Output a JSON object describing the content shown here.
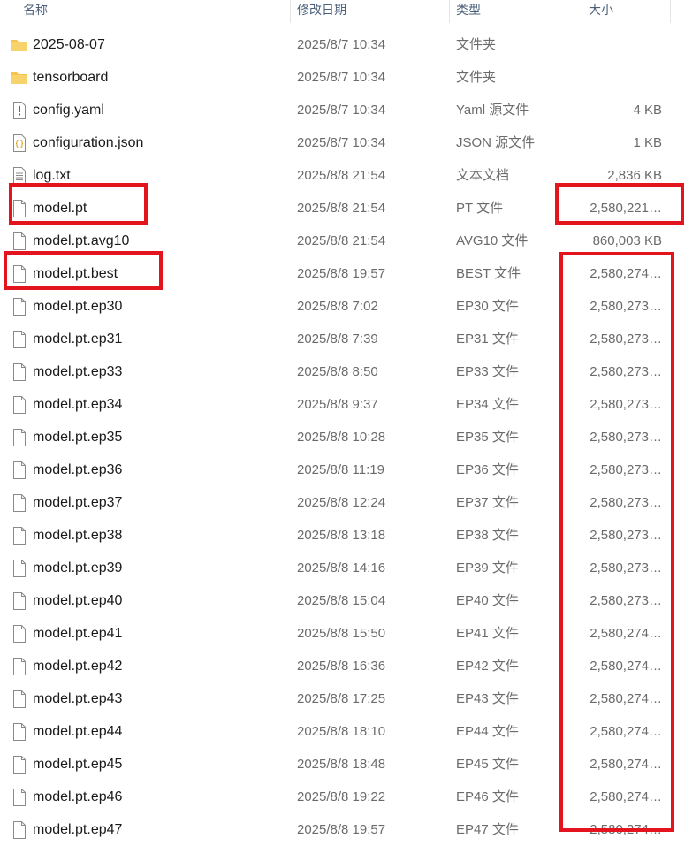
{
  "columns": {
    "name": "名称",
    "modified": "修改日期",
    "type": "类型",
    "size": "大小"
  },
  "files": [
    {
      "name": "2025-08-07",
      "modified": "2025/8/7 10:34",
      "type": "文件夹",
      "size": "",
      "icon": "folder-icon"
    },
    {
      "name": "tensorboard",
      "modified": "2025/8/7 10:34",
      "type": "文件夹",
      "size": "",
      "icon": "folder-icon"
    },
    {
      "name": "config.yaml",
      "modified": "2025/8/7 10:34",
      "type": "Yaml 源文件",
      "size": "4 KB",
      "icon": "yaml-file-icon"
    },
    {
      "name": "configuration.json",
      "modified": "2025/8/7 10:34",
      "type": "JSON 源文件",
      "size": "1 KB",
      "icon": "json-file-icon"
    },
    {
      "name": "log.txt",
      "modified": "2025/8/8 21:54",
      "type": "文本文档",
      "size": "2,836 KB",
      "icon": "text-file-icon"
    },
    {
      "name": "model.pt",
      "modified": "2025/8/8 21:54",
      "type": "PT 文件",
      "size": "2,580,221…",
      "icon": "file-icon"
    },
    {
      "name": "model.pt.avg10",
      "modified": "2025/8/8 21:54",
      "type": "AVG10 文件",
      "size": "860,003 KB",
      "icon": "file-icon"
    },
    {
      "name": "model.pt.best",
      "modified": "2025/8/8 19:57",
      "type": "BEST 文件",
      "size": "2,580,274…",
      "icon": "file-icon"
    },
    {
      "name": "model.pt.ep30",
      "modified": "2025/8/8 7:02",
      "type": "EP30 文件",
      "size": "2,580,273…",
      "icon": "file-icon"
    },
    {
      "name": "model.pt.ep31",
      "modified": "2025/8/8 7:39",
      "type": "EP31 文件",
      "size": "2,580,273…",
      "icon": "file-icon"
    },
    {
      "name": "model.pt.ep33",
      "modified": "2025/8/8 8:50",
      "type": "EP33 文件",
      "size": "2,580,273…",
      "icon": "file-icon"
    },
    {
      "name": "model.pt.ep34",
      "modified": "2025/8/8 9:37",
      "type": "EP34 文件",
      "size": "2,580,273…",
      "icon": "file-icon"
    },
    {
      "name": "model.pt.ep35",
      "modified": "2025/8/8 10:28",
      "type": "EP35 文件",
      "size": "2,580,273…",
      "icon": "file-icon"
    },
    {
      "name": "model.pt.ep36",
      "modified": "2025/8/8 11:19",
      "type": "EP36 文件",
      "size": "2,580,273…",
      "icon": "file-icon"
    },
    {
      "name": "model.pt.ep37",
      "modified": "2025/8/8 12:24",
      "type": "EP37 文件",
      "size": "2,580,273…",
      "icon": "file-icon"
    },
    {
      "name": "model.pt.ep38",
      "modified": "2025/8/8 13:18",
      "type": "EP38 文件",
      "size": "2,580,273…",
      "icon": "file-icon"
    },
    {
      "name": "model.pt.ep39",
      "modified": "2025/8/8 14:16",
      "type": "EP39 文件",
      "size": "2,580,273…",
      "icon": "file-icon"
    },
    {
      "name": "model.pt.ep40",
      "modified": "2025/8/8 15:04",
      "type": "EP40 文件",
      "size": "2,580,273…",
      "icon": "file-icon"
    },
    {
      "name": "model.pt.ep41",
      "modified": "2025/8/8 15:50",
      "type": "EP41 文件",
      "size": "2,580,274…",
      "icon": "file-icon"
    },
    {
      "name": "model.pt.ep42",
      "modified": "2025/8/8 16:36",
      "type": "EP42 文件",
      "size": "2,580,274…",
      "icon": "file-icon"
    },
    {
      "name": "model.pt.ep43",
      "modified": "2025/8/8 17:25",
      "type": "EP43 文件",
      "size": "2,580,274…",
      "icon": "file-icon"
    },
    {
      "name": "model.pt.ep44",
      "modified": "2025/8/8 18:10",
      "type": "EP44 文件",
      "size": "2,580,274…",
      "icon": "file-icon"
    },
    {
      "name": "model.pt.ep45",
      "modified": "2025/8/8 18:48",
      "type": "EP45 文件",
      "size": "2,580,274…",
      "icon": "file-icon"
    },
    {
      "name": "model.pt.ep46",
      "modified": "2025/8/8 19:22",
      "type": "EP46 文件",
      "size": "2,580,274…",
      "icon": "file-icon"
    },
    {
      "name": "model.pt.ep47",
      "modified": "2025/8/8 19:57",
      "type": "EP47 文件",
      "size": "2,580,274…",
      "icon": "file-icon"
    }
  ],
  "colors": {
    "annotation": "#e3141e",
    "folder": "#f4c44e"
  }
}
